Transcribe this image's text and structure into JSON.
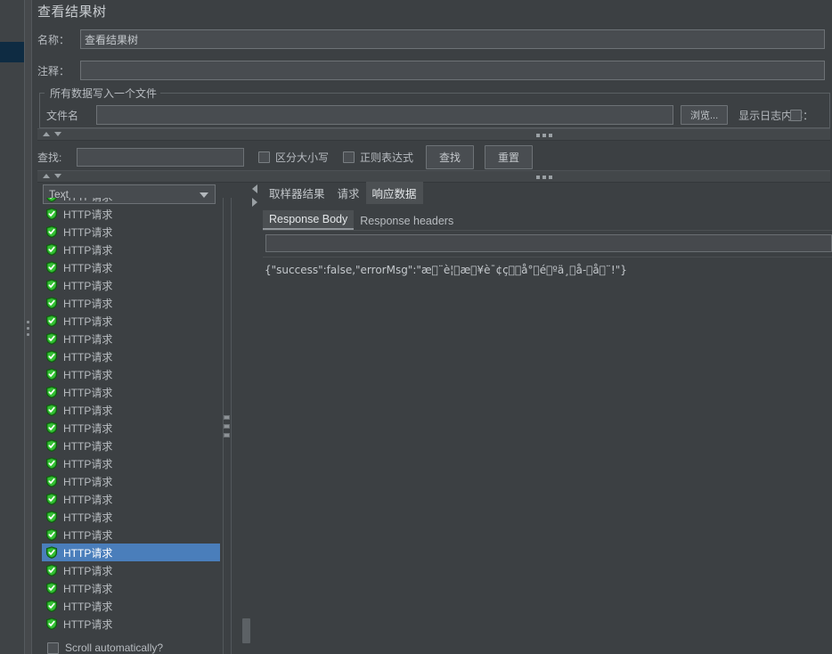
{
  "window": {
    "title": "查看结果树"
  },
  "fields": {
    "name_label": "名称：",
    "name_value": "查看结果树",
    "comment_label": "注释：",
    "comment_value": "",
    "groupbox_title": "所有数据写入一个文件",
    "filename_label": "文件名",
    "filename_value": "",
    "browse_button": "浏览...",
    "log_content_label": "显示日志内容："
  },
  "search": {
    "label": "查找:",
    "value": "",
    "case_sensitive_label": "区分大小写",
    "regex_label": "正则表达式",
    "find_button": "查找",
    "reset_button": "重置"
  },
  "renderer": {
    "selected": "Text"
  },
  "tree": {
    "nodes": [
      {
        "label": "HTTP请求",
        "selected": false
      },
      {
        "label": "HTTP请求",
        "selected": false
      },
      {
        "label": "HTTP请求",
        "selected": false
      },
      {
        "label": "HTTP请求",
        "selected": false
      },
      {
        "label": "HTTP请求",
        "selected": false
      },
      {
        "label": "HTTP请求",
        "selected": false
      },
      {
        "label": "HTTP请求",
        "selected": false
      },
      {
        "label": "HTTP请求",
        "selected": false
      },
      {
        "label": "HTTP请求",
        "selected": false
      },
      {
        "label": "HTTP请求",
        "selected": false
      },
      {
        "label": "HTTP请求",
        "selected": false
      },
      {
        "label": "HTTP请求",
        "selected": false
      },
      {
        "label": "HTTP请求",
        "selected": false
      },
      {
        "label": "HTTP请求",
        "selected": false
      },
      {
        "label": "HTTP请求",
        "selected": false
      },
      {
        "label": "HTTP请求",
        "selected": false
      },
      {
        "label": "HTTP请求",
        "selected": false
      },
      {
        "label": "HTTP请求",
        "selected": false
      },
      {
        "label": "HTTP请求",
        "selected": false
      },
      {
        "label": "HTTP请求",
        "selected": false
      },
      {
        "label": "HTTP请求",
        "selected": true
      },
      {
        "label": "HTTP请求",
        "selected": false
      },
      {
        "label": "HTTP请求",
        "selected": false
      },
      {
        "label": "HTTP请求",
        "selected": false
      },
      {
        "label": "HTTP请求",
        "selected": false
      }
    ],
    "scroll_automatically_label": "Scroll automatically?"
  },
  "tabs": {
    "items": [
      {
        "label": "取样器结果",
        "active": false
      },
      {
        "label": "请求",
        "active": false
      },
      {
        "label": "响应数据",
        "active": true
      }
    ]
  },
  "subtabs": {
    "items": [
      {
        "label": "Response Body",
        "active": true
      },
      {
        "label": "Response headers",
        "active": false
      }
    ]
  },
  "response": {
    "find_value": "",
    "body": "{\"success\":false,\"errorMsg\":\"æ\u0000¨è¦\u0000æ\u0000¥è¯¢ç\u0000\u0000å°\u0000é\u0000ºä¸\u0000å-\u0000å\u0000¨!\"}"
  },
  "colors": {
    "accent_selection": "#4a7ebb",
    "shield_green": "#2aa52a",
    "panel_bg": "#3c4043",
    "strip_selected": "#0e2b42"
  }
}
